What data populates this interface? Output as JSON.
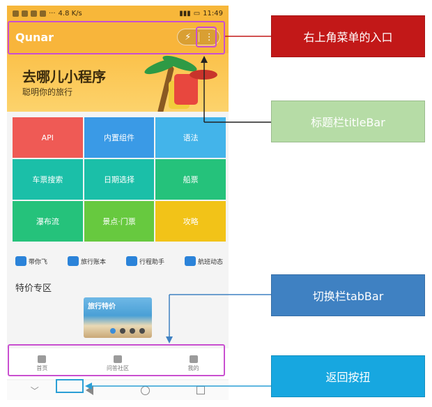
{
  "status_bar": {
    "speed": "4.8 K/s",
    "time": "11:49"
  },
  "title_bar": {
    "title": "Qunar",
    "capsule_left": "⚡",
    "capsule_right": "⋮"
  },
  "hero": {
    "title": "去哪儿小程序",
    "subtitle": "聪明你的旅行"
  },
  "grid": {
    "cells": [
      "API",
      "内置组件",
      "语法",
      "车票搜索",
      "日期选择",
      "船票",
      "瀑布流",
      "景点·门票",
      "攻略"
    ]
  },
  "quick_icons": [
    "带你飞",
    "旅行账本",
    "行程助手",
    "航班动态"
  ],
  "section": {
    "title": "特价专区"
  },
  "promo": {
    "caption": "旅行特价"
  },
  "tab_bar": {
    "tabs": [
      "首页",
      "问答社区",
      "我的"
    ]
  },
  "annotations": {
    "menu_entry": "右上角菜单的入口",
    "title_bar": "标题栏titleBar",
    "tab_bar": "切换栏tabBar",
    "back_button": "返回按扭"
  },
  "colors": {
    "accent_orange": "#f8b53b",
    "highlight_purple": "#c94fd0",
    "callout_red": "#c21818",
    "callout_green": "#b6dca6",
    "callout_blue": "#3f81c2",
    "callout_cyan": "#17a7e0"
  }
}
